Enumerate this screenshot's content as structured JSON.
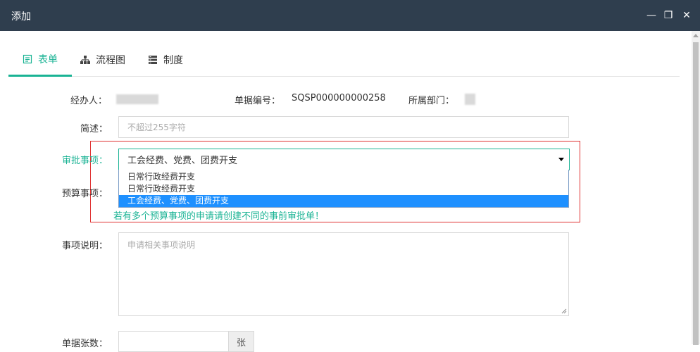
{
  "window": {
    "title": "添加",
    "minimize": "—",
    "maximize": "❐",
    "close": "✕"
  },
  "tabs": [
    {
      "label": "表单",
      "icon": "form-icon",
      "active": true
    },
    {
      "label": "流程图",
      "icon": "flowchart-icon",
      "active": false
    },
    {
      "label": "制度",
      "icon": "regulation-icon",
      "active": false
    }
  ],
  "form": {
    "handler_label": "经办人：",
    "doc_no_label": "单据编号：",
    "doc_no_value": "SQSP000000000258",
    "dept_label": "所属部门：",
    "summary_label": "简述：",
    "summary_placeholder": "不超过255字符",
    "approval_label": "审批事项：",
    "approval_value": "工会经费、党费、团费开支",
    "approval_options": [
      "日常行政经费开支",
      "日常行政经费开支",
      "工会经费、党费、团费开支"
    ],
    "approval_selected_index": 2,
    "budget_label": "预算事项：",
    "budget_hint": "若有多个预算事项的申请请创建不同的事前审批单！",
    "desc_label": "事项说明：",
    "desc_placeholder": "申请相关事项说明",
    "count_label": "单据张数：",
    "count_unit": "张"
  },
  "colors": {
    "titlebar": "#2f3e4e",
    "accent": "#1ab394",
    "highlight": "#1e90ff",
    "alert_border": "#e03333"
  }
}
